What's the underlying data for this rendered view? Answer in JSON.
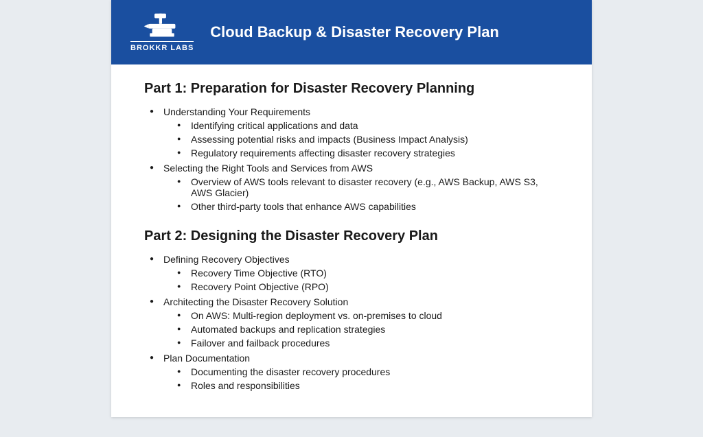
{
  "header": {
    "title": "Cloud Backup & Disaster Recovery Plan",
    "logo_brand": "BROKKR LABS"
  },
  "parts": [
    {
      "id": "part1",
      "heading": "Part 1: Preparation for Disaster Recovery Planning",
      "items": [
        {
          "label": "Understanding Your Requirements",
          "sub_items": [
            "Identifying critical applications and data",
            "Assessing potential risks and impacts (Business Impact Analysis)",
            "Regulatory requirements affecting disaster recovery strategies"
          ]
        },
        {
          "label": "Selecting the Right Tools and Services from AWS",
          "sub_items": [
            "Overview of AWS tools relevant to disaster recovery (e.g., AWS Backup, AWS S3, AWS Glacier)",
            "Other third-party tools that enhance AWS capabilities"
          ]
        }
      ]
    },
    {
      "id": "part2",
      "heading": "Part 2: Designing the Disaster Recovery Plan",
      "items": [
        {
          "label": "Defining Recovery Objectives",
          "sub_items": [
            "Recovery Time Objective (RTO)",
            "Recovery Point Objective (RPO)"
          ]
        },
        {
          "label": "Architecting the Disaster Recovery Solution",
          "sub_items": [
            "On AWS: Multi-region deployment vs. on-premises to cloud",
            "Automated backups and replication strategies",
            "Failover and failback procedures"
          ]
        },
        {
          "label": "Plan Documentation",
          "faded": true,
          "sub_items": [
            "Documenting the disaster recovery procedures",
            "Roles and responsibilities"
          ]
        }
      ]
    }
  ]
}
